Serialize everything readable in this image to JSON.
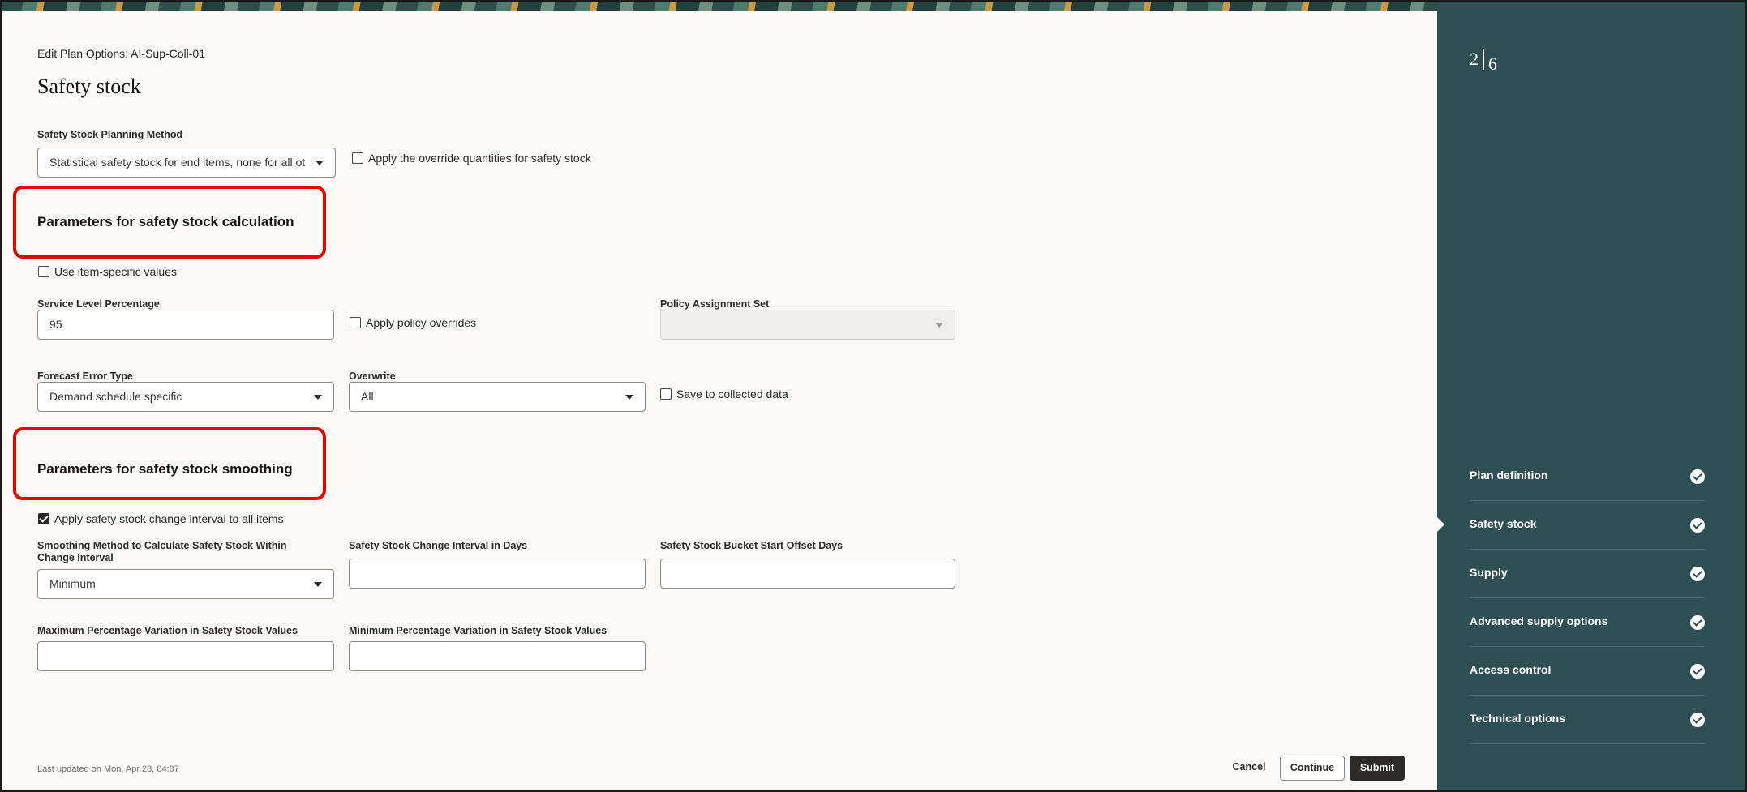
{
  "header": {
    "breadcrumb": "Edit Plan Options: AI-Sup-Coll-01",
    "title": "Safety stock"
  },
  "planning_method": {
    "label": "Safety Stock Planning Method",
    "value": "Statistical safety stock for end items, none for all ot",
    "override_label": "Apply the override quantities for safety stock",
    "override_checked": false
  },
  "calculation": {
    "title": "Parameters for safety stock calculation",
    "item_specific_label": "Use item-specific values",
    "service_level_label": "Service Level Percentage",
    "service_level_value": "95",
    "policy_overrides_label": "Apply policy overrides",
    "policy_assignment_label": "Policy Assignment Set",
    "policy_assignment_value": "",
    "forecast_error_label": "Forecast Error Type",
    "forecast_error_value": "Demand schedule specific",
    "overwrite_label": "Overwrite",
    "overwrite_value": "All",
    "save_collected_label": "Save to collected data"
  },
  "smoothing": {
    "title": "Parameters for safety stock smoothing",
    "apply_interval_label": "Apply safety stock change interval to all items",
    "apply_interval_checked": true,
    "method_label": "Smoothing Method to Calculate Safety Stock Within Change Interval",
    "method_value": "Minimum",
    "change_interval_label": "Safety Stock Change Interval in Days",
    "change_interval_value": "",
    "bucket_offset_label": "Safety Stock Bucket Start Offset Days",
    "bucket_offset_value": "",
    "max_variation_label": "Maximum Percentage Variation in Safety Stock Values",
    "max_variation_value": "",
    "min_variation_label": "Minimum Percentage Variation in Safety Stock Values",
    "min_variation_value": ""
  },
  "footer": {
    "last_updated": "Last updated on Mon, Apr 28, 04:07",
    "cancel": "Cancel",
    "continue": "Continue",
    "submit": "Submit"
  },
  "train": {
    "step_current": "2",
    "step_total": "6",
    "steps": [
      {
        "label": "Plan definition",
        "state": "complete"
      },
      {
        "label": "Safety stock",
        "state": "current"
      },
      {
        "label": "Supply",
        "state": "complete"
      },
      {
        "label": "Advanced supply options",
        "state": "complete"
      },
      {
        "label": "Access control",
        "state": "complete"
      },
      {
        "label": "Technical options",
        "state": "complete"
      }
    ]
  },
  "colors": {
    "sidebar": "#2f5052",
    "highlight": "#e60000",
    "background": "#fbf9f8"
  }
}
